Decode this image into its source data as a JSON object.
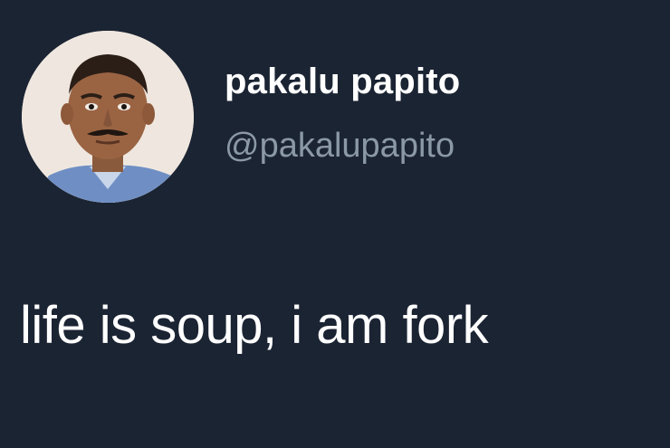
{
  "tweet": {
    "author": {
      "display_name": "pakalu papito",
      "handle": "@pakalupapito",
      "avatar_icon": "profile-photo"
    },
    "text": "life is soup, i am fork"
  },
  "colors": {
    "background": "#1b2433",
    "name_text": "#ffffff",
    "handle_text": "#8b98a5",
    "body_text": "#ffffff"
  }
}
